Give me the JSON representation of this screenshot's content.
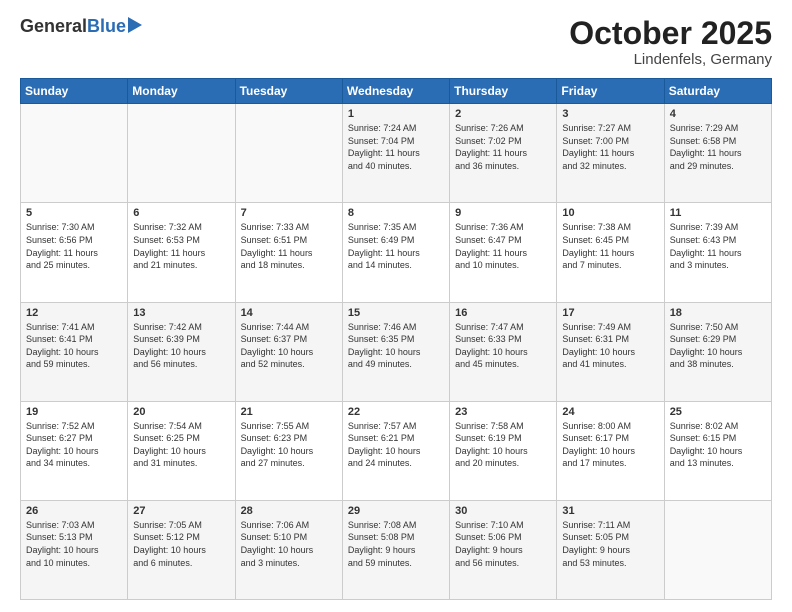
{
  "header": {
    "logo_general": "General",
    "logo_blue": "Blue",
    "month": "October 2025",
    "location": "Lindenfels, Germany"
  },
  "days_of_week": [
    "Sunday",
    "Monday",
    "Tuesday",
    "Wednesday",
    "Thursday",
    "Friday",
    "Saturday"
  ],
  "weeks": [
    [
      {
        "day": "",
        "info": ""
      },
      {
        "day": "",
        "info": ""
      },
      {
        "day": "",
        "info": ""
      },
      {
        "day": "1",
        "info": "Sunrise: 7:24 AM\nSunset: 7:04 PM\nDaylight: 11 hours\nand 40 minutes."
      },
      {
        "day": "2",
        "info": "Sunrise: 7:26 AM\nSunset: 7:02 PM\nDaylight: 11 hours\nand 36 minutes."
      },
      {
        "day": "3",
        "info": "Sunrise: 7:27 AM\nSunset: 7:00 PM\nDaylight: 11 hours\nand 32 minutes."
      },
      {
        "day": "4",
        "info": "Sunrise: 7:29 AM\nSunset: 6:58 PM\nDaylight: 11 hours\nand 29 minutes."
      }
    ],
    [
      {
        "day": "5",
        "info": "Sunrise: 7:30 AM\nSunset: 6:56 PM\nDaylight: 11 hours\nand 25 minutes."
      },
      {
        "day": "6",
        "info": "Sunrise: 7:32 AM\nSunset: 6:53 PM\nDaylight: 11 hours\nand 21 minutes."
      },
      {
        "day": "7",
        "info": "Sunrise: 7:33 AM\nSunset: 6:51 PM\nDaylight: 11 hours\nand 18 minutes."
      },
      {
        "day": "8",
        "info": "Sunrise: 7:35 AM\nSunset: 6:49 PM\nDaylight: 11 hours\nand 14 minutes."
      },
      {
        "day": "9",
        "info": "Sunrise: 7:36 AM\nSunset: 6:47 PM\nDaylight: 11 hours\nand 10 minutes."
      },
      {
        "day": "10",
        "info": "Sunrise: 7:38 AM\nSunset: 6:45 PM\nDaylight: 11 hours\nand 7 minutes."
      },
      {
        "day": "11",
        "info": "Sunrise: 7:39 AM\nSunset: 6:43 PM\nDaylight: 11 hours\nand 3 minutes."
      }
    ],
    [
      {
        "day": "12",
        "info": "Sunrise: 7:41 AM\nSunset: 6:41 PM\nDaylight: 10 hours\nand 59 minutes."
      },
      {
        "day": "13",
        "info": "Sunrise: 7:42 AM\nSunset: 6:39 PM\nDaylight: 10 hours\nand 56 minutes."
      },
      {
        "day": "14",
        "info": "Sunrise: 7:44 AM\nSunset: 6:37 PM\nDaylight: 10 hours\nand 52 minutes."
      },
      {
        "day": "15",
        "info": "Sunrise: 7:46 AM\nSunset: 6:35 PM\nDaylight: 10 hours\nand 49 minutes."
      },
      {
        "day": "16",
        "info": "Sunrise: 7:47 AM\nSunset: 6:33 PM\nDaylight: 10 hours\nand 45 minutes."
      },
      {
        "day": "17",
        "info": "Sunrise: 7:49 AM\nSunset: 6:31 PM\nDaylight: 10 hours\nand 41 minutes."
      },
      {
        "day": "18",
        "info": "Sunrise: 7:50 AM\nSunset: 6:29 PM\nDaylight: 10 hours\nand 38 minutes."
      }
    ],
    [
      {
        "day": "19",
        "info": "Sunrise: 7:52 AM\nSunset: 6:27 PM\nDaylight: 10 hours\nand 34 minutes."
      },
      {
        "day": "20",
        "info": "Sunrise: 7:54 AM\nSunset: 6:25 PM\nDaylight: 10 hours\nand 31 minutes."
      },
      {
        "day": "21",
        "info": "Sunrise: 7:55 AM\nSunset: 6:23 PM\nDaylight: 10 hours\nand 27 minutes."
      },
      {
        "day": "22",
        "info": "Sunrise: 7:57 AM\nSunset: 6:21 PM\nDaylight: 10 hours\nand 24 minutes."
      },
      {
        "day": "23",
        "info": "Sunrise: 7:58 AM\nSunset: 6:19 PM\nDaylight: 10 hours\nand 20 minutes."
      },
      {
        "day": "24",
        "info": "Sunrise: 8:00 AM\nSunset: 6:17 PM\nDaylight: 10 hours\nand 17 minutes."
      },
      {
        "day": "25",
        "info": "Sunrise: 8:02 AM\nSunset: 6:15 PM\nDaylight: 10 hours\nand 13 minutes."
      }
    ],
    [
      {
        "day": "26",
        "info": "Sunrise: 7:03 AM\nSunset: 5:13 PM\nDaylight: 10 hours\nand 10 minutes."
      },
      {
        "day": "27",
        "info": "Sunrise: 7:05 AM\nSunset: 5:12 PM\nDaylight: 10 hours\nand 6 minutes."
      },
      {
        "day": "28",
        "info": "Sunrise: 7:06 AM\nSunset: 5:10 PM\nDaylight: 10 hours\nand 3 minutes."
      },
      {
        "day": "29",
        "info": "Sunrise: 7:08 AM\nSunset: 5:08 PM\nDaylight: 9 hours\nand 59 minutes."
      },
      {
        "day": "30",
        "info": "Sunrise: 7:10 AM\nSunset: 5:06 PM\nDaylight: 9 hours\nand 56 minutes."
      },
      {
        "day": "31",
        "info": "Sunrise: 7:11 AM\nSunset: 5:05 PM\nDaylight: 9 hours\nand 53 minutes."
      },
      {
        "day": "",
        "info": ""
      }
    ]
  ]
}
